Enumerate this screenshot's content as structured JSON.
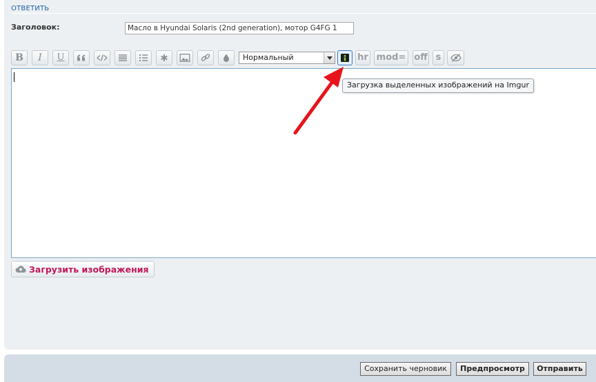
{
  "section": {
    "title": "ОТВЕТИТЬ"
  },
  "subject": {
    "label": "Заголовок:",
    "value": "Масло в Hyundai Solaris (2nd generation), мотор G4FG 1"
  },
  "toolbar": {
    "bold": "B",
    "italic": "I",
    "underline": "U",
    "font_size": "Нормальный",
    "hr": "hr",
    "mod": "mod=",
    "off": "off",
    "s": "s"
  },
  "tooltip": {
    "text": "Загрузка выделенных изображений на Imgur"
  },
  "upload": {
    "label": "Загрузить изображения"
  },
  "buttons": {
    "save_draft": "Сохранить черновик",
    "preview": "Предпросмотр",
    "submit": "Отправить"
  },
  "colors": {
    "accent": "#1e5fa6",
    "upload_text": "#c2185b",
    "annotation_arrow": "#e8141b"
  }
}
